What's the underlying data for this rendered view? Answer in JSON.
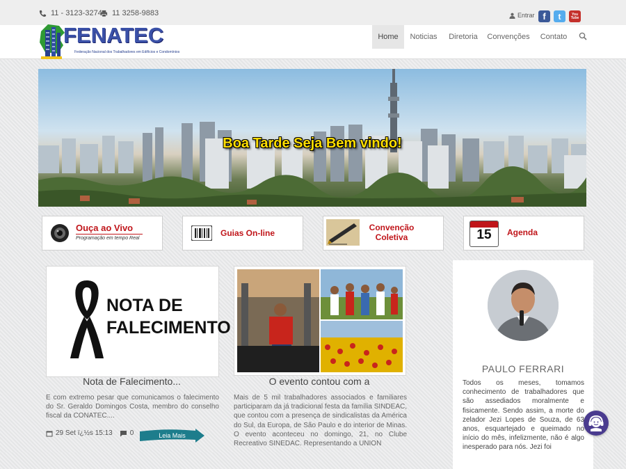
{
  "topbar": {
    "phone": "11 - 3123-3274",
    "fax": "11 3258-9883",
    "login_label": "Entrar",
    "social": [
      {
        "name": "facebook",
        "glyph": "f",
        "color": "#3b5998"
      },
      {
        "name": "twitter",
        "glyph": "t",
        "color": "#55acee"
      },
      {
        "name": "youtube",
        "glyph": "You Tube",
        "color": "#c4302b"
      }
    ]
  },
  "header": {
    "logo_text": "FENATEC",
    "logo_subtitle": "Federação Nacional dos Trabalhadores em Edifícios e Condomínios",
    "nav": [
      "Home",
      "Noticias",
      "Diretoria",
      "Convenções",
      "Contato"
    ],
    "active_nav": "Home"
  },
  "banner": {
    "text": "Boa Tarde Seja Bem vindo!"
  },
  "quick_links": [
    {
      "label": "Ouça ao Vivo",
      "sub": "Programação em tempo Real",
      "icon": "speaker-icon"
    },
    {
      "label": "Guias On-line",
      "icon": "barcode-icon"
    },
    {
      "label": "Convenção Coletiva",
      "icon": "pen-icon"
    },
    {
      "label": "Agenda",
      "icon": "calendar-icon",
      "calendar_day": "15"
    }
  ],
  "articles": [
    {
      "image_text_line1": "NOTA DE",
      "image_text_line2": "FALECIMENTO",
      "title": "Nota de Falecimento...",
      "excerpt": "E com extremo pesar que comunicamos o falecimento do Sr. Geraldo Domingos Costa, membro do conselho fiscal da CONATEC....",
      "date": "29 Set ï¿½s 15:13",
      "comments": "0",
      "read_more": "Leia Mais"
    },
    {
      "title": "O evento contou com a",
      "excerpt": "Mais de 5 mil trabalhadores associados e familiares participaram da já tradicional festa da família SINDEAC, que contou com a presença de sindicalistas da América do Sul, da Europa, de São Paulo e do interior de Minas. O evento aconteceu no domingo, 21, no Clube Recreativo SINEDAC. Representando a UNION"
    }
  ],
  "sidebar": {
    "name": "PAULO FERRARI",
    "text": "Todos os meses, tomamos conhecimento de trabalhadores que são assediados moralmente e fisicamente. Sendo assim, a morte do zelador Jezi Lopes de Souza, de 63 anos, esquartejado e queimado no início do mês, infelizmente, não é algo inesperado para nós. Jezi foi"
  },
  "colors": {
    "accent_red": "#c0151a",
    "banner_text": "#ffde00",
    "logo_blue": "#3b51a8",
    "read_more_teal": "#1d7d8c",
    "chat_purple": "#4a3b8f"
  }
}
